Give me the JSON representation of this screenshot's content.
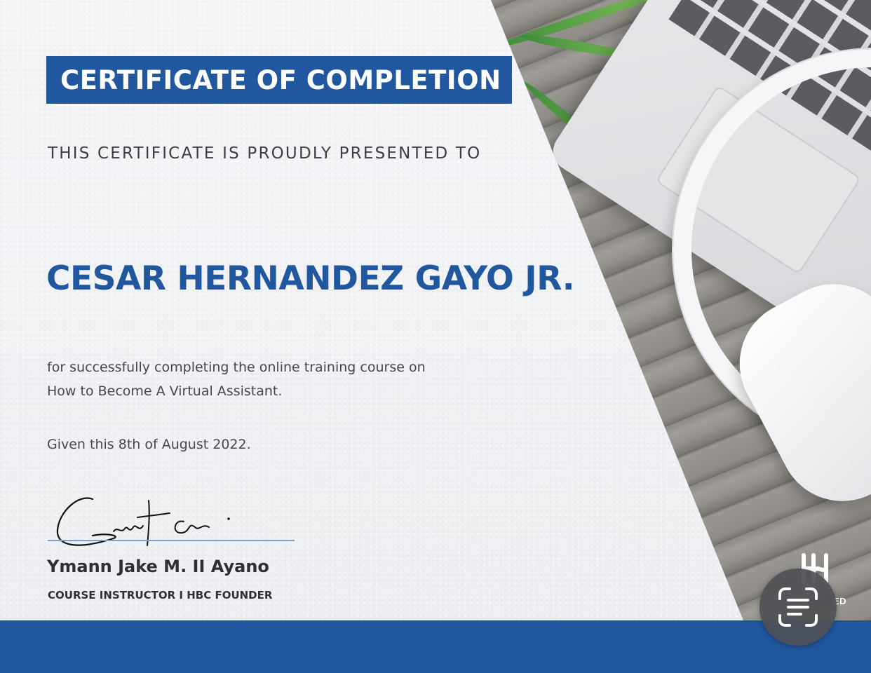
{
  "certificate": {
    "title": "CERTIFICATE OF COMPLETION",
    "presented_line": "THIS CERTIFICATE IS PROUDLY PRESENTED TO",
    "recipient": "CESAR HERNANDEZ GAYO JR.",
    "description_line1": "for successfully completing the online training course on",
    "description_line2": "How to Become A Virtual Assistant.",
    "given_date": "Given this 8th of August 2022.",
    "signer_name": "Ymann Jake M. II Ayano",
    "signer_role": "COURSE INSTRUCTOR I HBC FOUNDER",
    "logo_tail": "ED"
  },
  "icons": {
    "scan": "live-text-scan-icon",
    "logo": "hbc-logo-icon"
  },
  "colors": {
    "brand_blue": "#21579f",
    "text_dark": "#2d2f33",
    "text_gray": "#45474c",
    "signature_line": "#7ea0cf"
  }
}
